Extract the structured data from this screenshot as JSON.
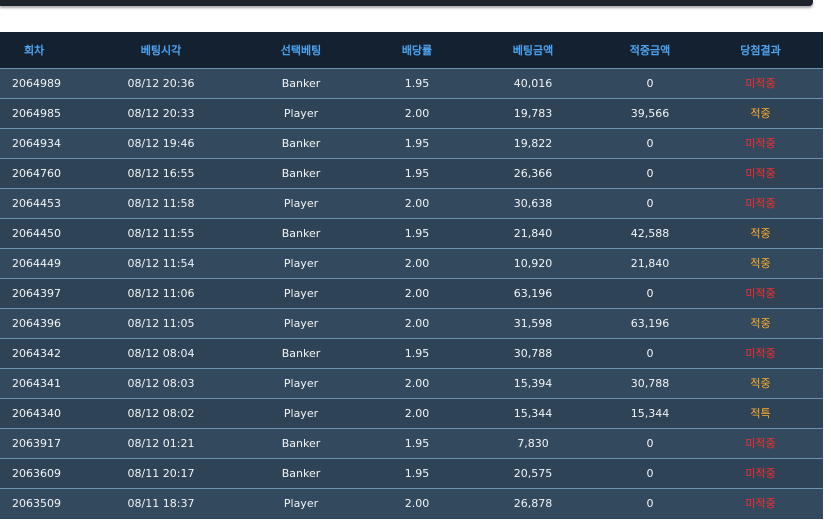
{
  "colors": {
    "header_bg": "#142130",
    "header_text": "#4da3ef",
    "row_bg": "#33495d",
    "row_border": "#6b93b0",
    "lose": "#ff2b2b",
    "win": "#ffae2a"
  },
  "table": {
    "headers": [
      "회차",
      "베팅시각",
      "선택베팅",
      "배당률",
      "베팅금액",
      "적중금액",
      "당첨결과"
    ],
    "rows": [
      {
        "round": "2064989",
        "time": "08/12 20:36",
        "pick": "Banker",
        "odds": "1.95",
        "bet": "40,016",
        "payout": "0",
        "result": "미적중",
        "status": "lose"
      },
      {
        "round": "2064985",
        "time": "08/12 20:33",
        "pick": "Player",
        "odds": "2.00",
        "bet": "19,783",
        "payout": "39,566",
        "result": "적중",
        "status": "win"
      },
      {
        "round": "2064934",
        "time": "08/12 19:46",
        "pick": "Banker",
        "odds": "1.95",
        "bet": "19,822",
        "payout": "0",
        "result": "미적중",
        "status": "lose"
      },
      {
        "round": "2064760",
        "time": "08/12 16:55",
        "pick": "Banker",
        "odds": "1.95",
        "bet": "26,366",
        "payout": "0",
        "result": "미적중",
        "status": "lose"
      },
      {
        "round": "2064453",
        "time": "08/12 11:58",
        "pick": "Player",
        "odds": "2.00",
        "bet": "30,638",
        "payout": "0",
        "result": "미적중",
        "status": "lose"
      },
      {
        "round": "2064450",
        "time": "08/12 11:55",
        "pick": "Banker",
        "odds": "1.95",
        "bet": "21,840",
        "payout": "42,588",
        "result": "적중",
        "status": "win"
      },
      {
        "round": "2064449",
        "time": "08/12 11:54",
        "pick": "Player",
        "odds": "2.00",
        "bet": "10,920",
        "payout": "21,840",
        "result": "적중",
        "status": "win"
      },
      {
        "round": "2064397",
        "time": "08/12 11:06",
        "pick": "Player",
        "odds": "2.00",
        "bet": "63,196",
        "payout": "0",
        "result": "미적중",
        "status": "lose"
      },
      {
        "round": "2064396",
        "time": "08/12 11:05",
        "pick": "Player",
        "odds": "2.00",
        "bet": "31,598",
        "payout": "63,196",
        "result": "적중",
        "status": "win"
      },
      {
        "round": "2064342",
        "time": "08/12 08:04",
        "pick": "Banker",
        "odds": "1.95",
        "bet": "30,788",
        "payout": "0",
        "result": "미적중",
        "status": "lose"
      },
      {
        "round": "2064341",
        "time": "08/12 08:03",
        "pick": "Player",
        "odds": "2.00",
        "bet": "15,394",
        "payout": "30,788",
        "result": "적중",
        "status": "win"
      },
      {
        "round": "2064340",
        "time": "08/12 08:02",
        "pick": "Player",
        "odds": "2.00",
        "bet": "15,344",
        "payout": "15,344",
        "result": "적특",
        "status": "win"
      },
      {
        "round": "2063917",
        "time": "08/12 01:21",
        "pick": "Banker",
        "odds": "1.95",
        "bet": "7,830",
        "payout": "0",
        "result": "미적중",
        "status": "lose"
      },
      {
        "round": "2063609",
        "time": "08/11 20:17",
        "pick": "Banker",
        "odds": "1.95",
        "bet": "20,575",
        "payout": "0",
        "result": "미적중",
        "status": "lose"
      },
      {
        "round": "2063509",
        "time": "08/11 18:37",
        "pick": "Player",
        "odds": "2.00",
        "bet": "26,878",
        "payout": "0",
        "result": "미적중",
        "status": "lose"
      }
    ]
  }
}
